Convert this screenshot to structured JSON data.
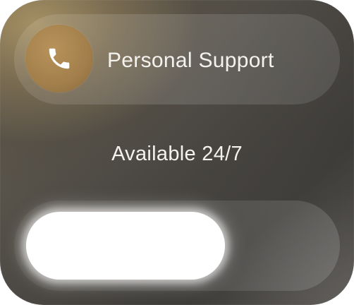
{
  "widget": {
    "title": "Personal Support",
    "subtitle": "Available 24/7",
    "icon": "phone-icon",
    "accent_color": "#a27f4b",
    "slider": {
      "value": 0
    }
  }
}
